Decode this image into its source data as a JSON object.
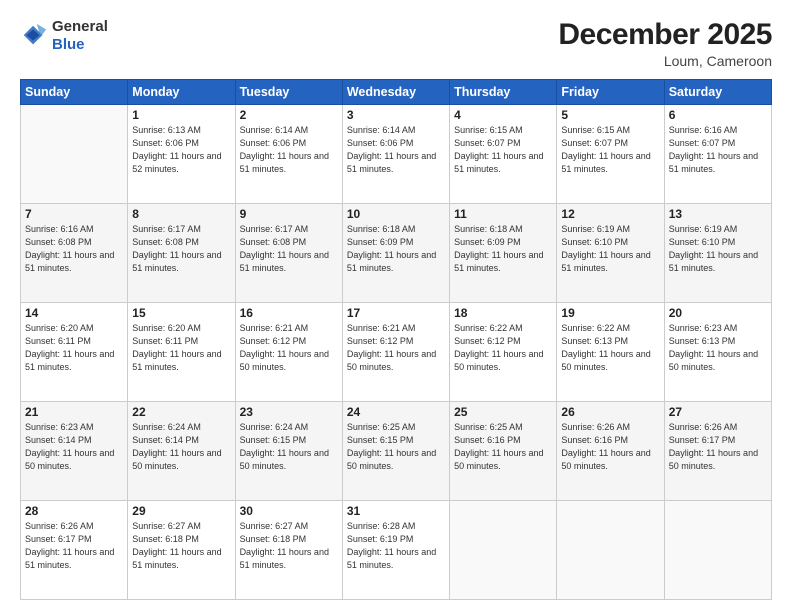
{
  "header": {
    "logo": {
      "line1": "General",
      "line2": "Blue"
    },
    "title": "December 2025",
    "location": "Loum, Cameroon"
  },
  "days_of_week": [
    "Sunday",
    "Monday",
    "Tuesday",
    "Wednesday",
    "Thursday",
    "Friday",
    "Saturday"
  ],
  "weeks": [
    [
      {
        "day": "",
        "sunrise": "",
        "sunset": "",
        "daylight": ""
      },
      {
        "day": "1",
        "sunrise": "6:13 AM",
        "sunset": "6:06 PM",
        "daylight": "11 hours and 52 minutes."
      },
      {
        "day": "2",
        "sunrise": "6:14 AM",
        "sunset": "6:06 PM",
        "daylight": "11 hours and 51 minutes."
      },
      {
        "day": "3",
        "sunrise": "6:14 AM",
        "sunset": "6:06 PM",
        "daylight": "11 hours and 51 minutes."
      },
      {
        "day": "4",
        "sunrise": "6:15 AM",
        "sunset": "6:07 PM",
        "daylight": "11 hours and 51 minutes."
      },
      {
        "day": "5",
        "sunrise": "6:15 AM",
        "sunset": "6:07 PM",
        "daylight": "11 hours and 51 minutes."
      },
      {
        "day": "6",
        "sunrise": "6:16 AM",
        "sunset": "6:07 PM",
        "daylight": "11 hours and 51 minutes."
      }
    ],
    [
      {
        "day": "7",
        "sunrise": "6:16 AM",
        "sunset": "6:08 PM",
        "daylight": "11 hours and 51 minutes."
      },
      {
        "day": "8",
        "sunrise": "6:17 AM",
        "sunset": "6:08 PM",
        "daylight": "11 hours and 51 minutes."
      },
      {
        "day": "9",
        "sunrise": "6:17 AM",
        "sunset": "6:08 PM",
        "daylight": "11 hours and 51 minutes."
      },
      {
        "day": "10",
        "sunrise": "6:18 AM",
        "sunset": "6:09 PM",
        "daylight": "11 hours and 51 minutes."
      },
      {
        "day": "11",
        "sunrise": "6:18 AM",
        "sunset": "6:09 PM",
        "daylight": "11 hours and 51 minutes."
      },
      {
        "day": "12",
        "sunrise": "6:19 AM",
        "sunset": "6:10 PM",
        "daylight": "11 hours and 51 minutes."
      },
      {
        "day": "13",
        "sunrise": "6:19 AM",
        "sunset": "6:10 PM",
        "daylight": "11 hours and 51 minutes."
      }
    ],
    [
      {
        "day": "14",
        "sunrise": "6:20 AM",
        "sunset": "6:11 PM",
        "daylight": "11 hours and 51 minutes."
      },
      {
        "day": "15",
        "sunrise": "6:20 AM",
        "sunset": "6:11 PM",
        "daylight": "11 hours and 51 minutes."
      },
      {
        "day": "16",
        "sunrise": "6:21 AM",
        "sunset": "6:12 PM",
        "daylight": "11 hours and 50 minutes."
      },
      {
        "day": "17",
        "sunrise": "6:21 AM",
        "sunset": "6:12 PM",
        "daylight": "11 hours and 50 minutes."
      },
      {
        "day": "18",
        "sunrise": "6:22 AM",
        "sunset": "6:12 PM",
        "daylight": "11 hours and 50 minutes."
      },
      {
        "day": "19",
        "sunrise": "6:22 AM",
        "sunset": "6:13 PM",
        "daylight": "11 hours and 50 minutes."
      },
      {
        "day": "20",
        "sunrise": "6:23 AM",
        "sunset": "6:13 PM",
        "daylight": "11 hours and 50 minutes."
      }
    ],
    [
      {
        "day": "21",
        "sunrise": "6:23 AM",
        "sunset": "6:14 PM",
        "daylight": "11 hours and 50 minutes."
      },
      {
        "day": "22",
        "sunrise": "6:24 AM",
        "sunset": "6:14 PM",
        "daylight": "11 hours and 50 minutes."
      },
      {
        "day": "23",
        "sunrise": "6:24 AM",
        "sunset": "6:15 PM",
        "daylight": "11 hours and 50 minutes."
      },
      {
        "day": "24",
        "sunrise": "6:25 AM",
        "sunset": "6:15 PM",
        "daylight": "11 hours and 50 minutes."
      },
      {
        "day": "25",
        "sunrise": "6:25 AM",
        "sunset": "6:16 PM",
        "daylight": "11 hours and 50 minutes."
      },
      {
        "day": "26",
        "sunrise": "6:26 AM",
        "sunset": "6:16 PM",
        "daylight": "11 hours and 50 minutes."
      },
      {
        "day": "27",
        "sunrise": "6:26 AM",
        "sunset": "6:17 PM",
        "daylight": "11 hours and 50 minutes."
      }
    ],
    [
      {
        "day": "28",
        "sunrise": "6:26 AM",
        "sunset": "6:17 PM",
        "daylight": "11 hours and 51 minutes."
      },
      {
        "day": "29",
        "sunrise": "6:27 AM",
        "sunset": "6:18 PM",
        "daylight": "11 hours and 51 minutes."
      },
      {
        "day": "30",
        "sunrise": "6:27 AM",
        "sunset": "6:18 PM",
        "daylight": "11 hours and 51 minutes."
      },
      {
        "day": "31",
        "sunrise": "6:28 AM",
        "sunset": "6:19 PM",
        "daylight": "11 hours and 51 minutes."
      },
      {
        "day": "",
        "sunrise": "",
        "sunset": "",
        "daylight": ""
      },
      {
        "day": "",
        "sunrise": "",
        "sunset": "",
        "daylight": ""
      },
      {
        "day": "",
        "sunrise": "",
        "sunset": "",
        "daylight": ""
      }
    ]
  ],
  "labels": {
    "sunrise_prefix": "Sunrise: ",
    "sunset_prefix": "Sunset: ",
    "daylight_prefix": "Daylight: "
  }
}
